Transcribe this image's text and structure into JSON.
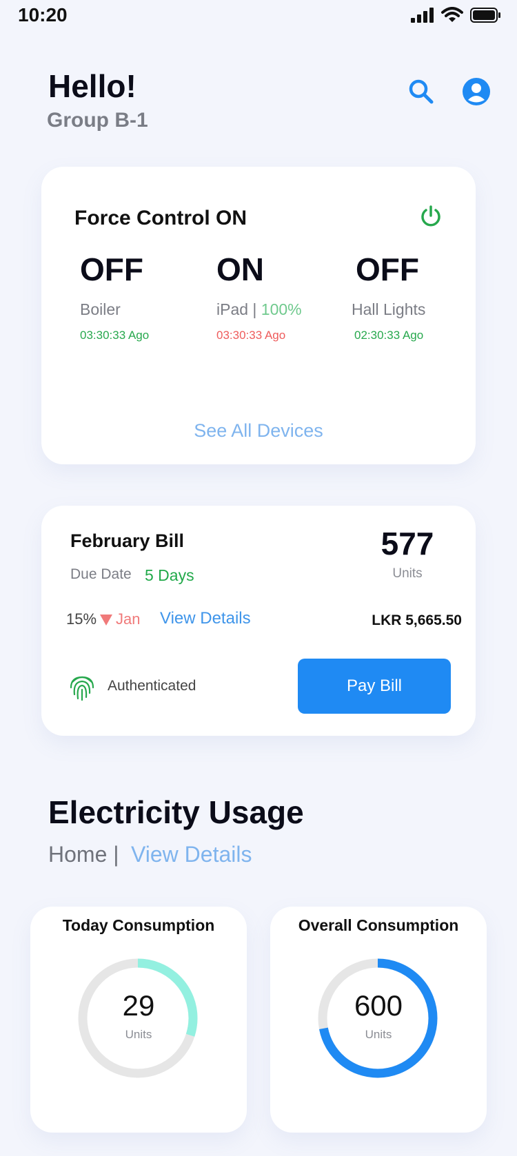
{
  "status": {
    "time": "10:20"
  },
  "header": {
    "greeting": "Hello!",
    "group": "Group B-1"
  },
  "force_control": {
    "title": "Force Control ON",
    "devices": [
      {
        "state": "OFF",
        "name": "Boiler",
        "extra": "",
        "time": "03:30:33 Ago",
        "time_color": "#27a84d"
      },
      {
        "state": "ON",
        "name": "iPad | ",
        "extra": "100%",
        "time": "03:30:33 Ago",
        "time_color": "#ee5b5b"
      },
      {
        "state": "OFF",
        "name": "Hall Lights",
        "extra": "",
        "time": "02:30:33 Ago",
        "time_color": "#27a84d"
      }
    ],
    "see_all": "See All Devices"
  },
  "bill": {
    "title": "February Bill",
    "due_label": "Due Date",
    "due_value": "5 Days",
    "units": "577",
    "units_label": "Units",
    "change_pct": "15%",
    "change_month": "Jan",
    "view_details": "View Details",
    "amount": "LKR 5,665.50",
    "auth_label": "Authenticated",
    "pay_label": "Pay Bill"
  },
  "usage": {
    "title": "Electricity Usage",
    "home": "Home |",
    "view_details": "View Details",
    "today": {
      "title": "Today Consumption",
      "value": "29",
      "unit": "Units",
      "fraction": 0.3,
      "color": "#93f0e0"
    },
    "overall": {
      "title": "Overall Consumption",
      "value": "600",
      "unit": "Units",
      "fraction": 0.72,
      "color": "#1f8af3"
    }
  }
}
